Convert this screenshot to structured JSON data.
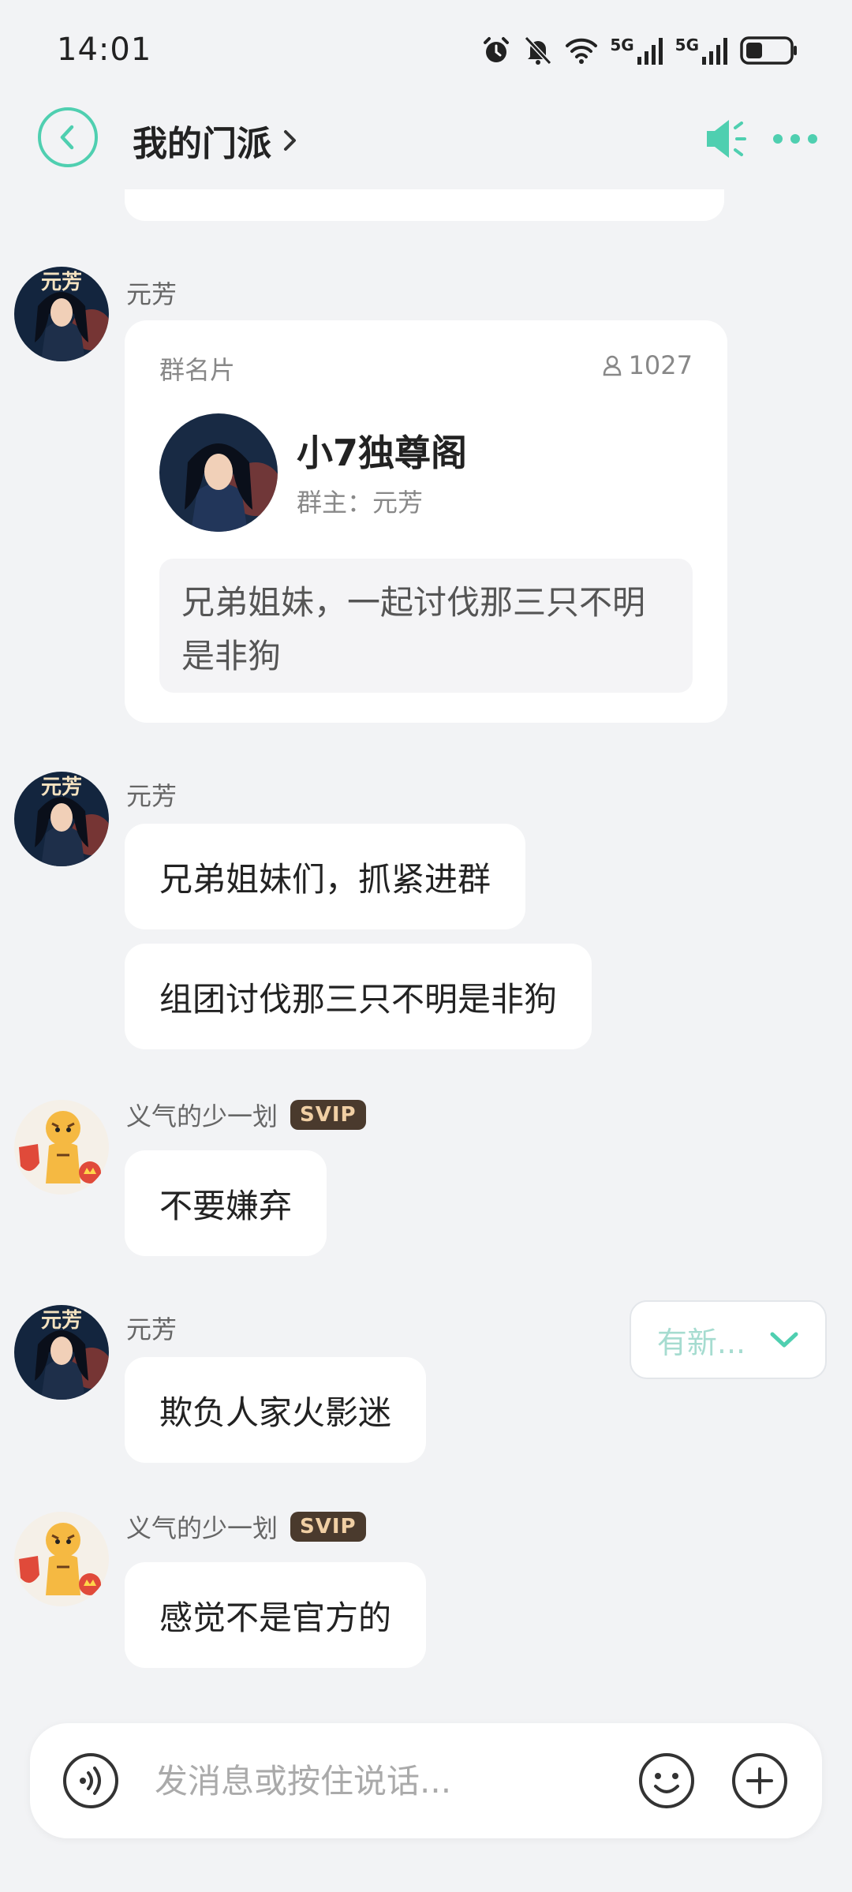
{
  "status": {
    "time": "14:01",
    "net1": "5G",
    "net2": "5G"
  },
  "header": {
    "title": "我的门派",
    "accent": "#4fcfb0"
  },
  "messages": [
    {
      "sender": "元芳",
      "type": "group_card",
      "card": {
        "label": "群名片",
        "member_count": "1027",
        "group_name": "小7独尊阁",
        "owner": "群主：元芳",
        "description": "兄弟姐妹，一起讨伐那三只不明是非狗"
      }
    },
    {
      "sender": "元芳",
      "bubbles": [
        "兄弟姐妹们，抓紧进群",
        "组团讨伐那三只不明是非狗"
      ]
    },
    {
      "sender": "义气的少一划",
      "badge": "SVIP",
      "bubbles": [
        "不要嫌弃"
      ]
    },
    {
      "sender": "元芳",
      "bubbles": [
        "欺负人家火影迷"
      ]
    },
    {
      "sender": "义气的少一划",
      "badge": "SVIP",
      "bubbles": [
        "感觉不是官方的"
      ]
    }
  ],
  "new_messages_label": "有新...",
  "input": {
    "placeholder": "发消息或按住说话..."
  }
}
